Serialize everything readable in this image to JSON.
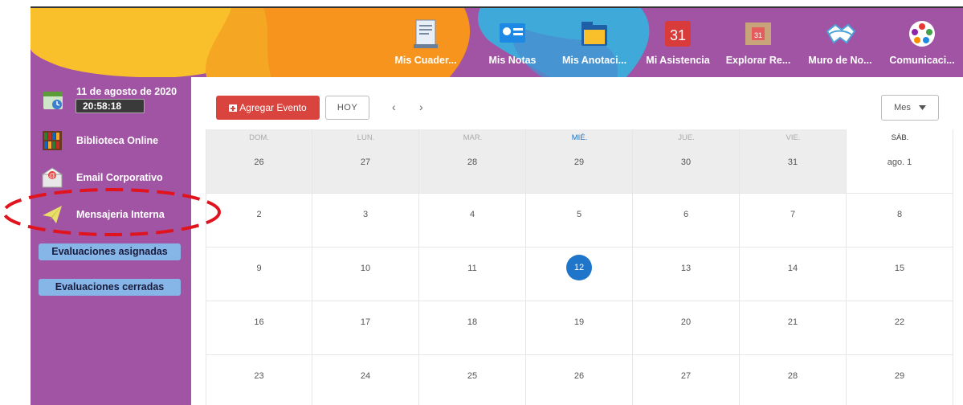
{
  "topnav": {
    "items": [
      {
        "label": "Mis Cuader...",
        "icon": "notebook-icon"
      },
      {
        "label": "Mis Notas",
        "icon": "notes-icon"
      },
      {
        "label": "Mis Anotaci...",
        "icon": "folder-icon"
      },
      {
        "label": "Mi Asistencia",
        "icon": "calendar-31-icon",
        "icon_text": "31"
      },
      {
        "label": "Explorar Re...",
        "icon": "explore-calendar-icon",
        "icon_text": "31"
      },
      {
        "label": "Muro de No...",
        "icon": "handshake-icon"
      },
      {
        "label": "Comunicaci...",
        "icon": "communication-icon"
      }
    ]
  },
  "sidebar": {
    "date": "11 de agosto de 2020",
    "time": "20:58:18",
    "items": [
      {
        "label": "Biblioteca Online",
        "icon": "bookshelf-icon"
      },
      {
        "label": "Email Corporativo",
        "icon": "email-icon"
      },
      {
        "label": "Mensajeria Interna",
        "icon": "paper-plane-icon"
      }
    ],
    "eval_buttons": [
      "Evaluaciones asignadas",
      "Evaluaciones cerradas"
    ]
  },
  "toolbar": {
    "add_event": "Agregar Evento",
    "today": "HOY",
    "prev": "‹",
    "next": "›",
    "view": "Mes"
  },
  "calendar": {
    "weekdays": [
      "DOM.",
      "LUN.",
      "MAR.",
      "MIÉ.",
      "JUE.",
      "VIE.",
      "SÁB."
    ],
    "current_weekday_index": 3,
    "today": "12",
    "weeks": [
      [
        "26",
        "27",
        "28",
        "29",
        "30",
        "31",
        "ago. 1"
      ],
      [
        "2",
        "3",
        "4",
        "5",
        "6",
        "7",
        "8"
      ],
      [
        "9",
        "10",
        "11",
        "12",
        "13",
        "14",
        "15"
      ],
      [
        "16",
        "17",
        "18",
        "19",
        "20",
        "21",
        "22"
      ],
      [
        "23",
        "24",
        "25",
        "26",
        "27",
        "28",
        "29"
      ]
    ]
  },
  "colors": {
    "purple": "#a254a4",
    "add_button": "#d9453e",
    "today_circle": "#1e75c9",
    "eval_button": "#86b6e8",
    "highlight": "#e0141e"
  }
}
